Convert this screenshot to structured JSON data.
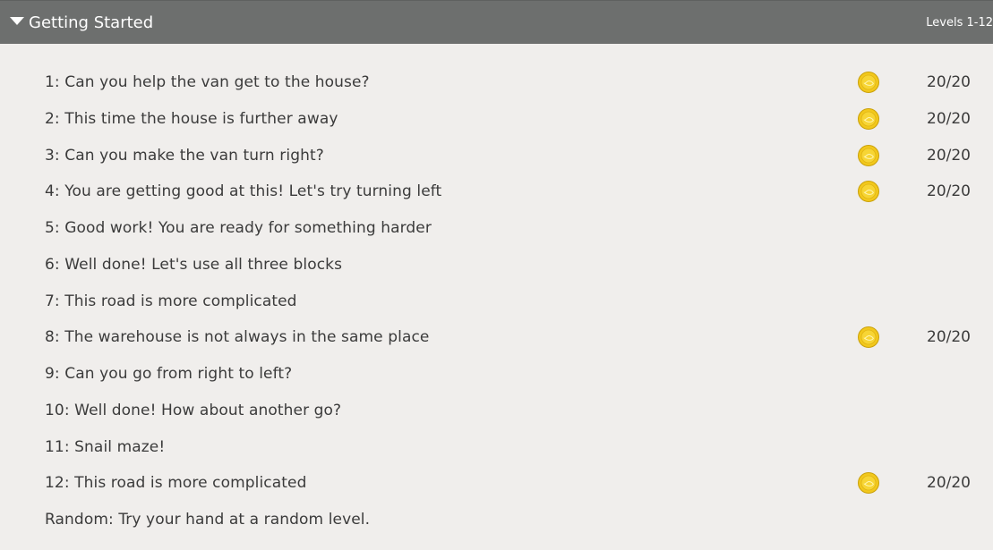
{
  "section": {
    "title": "Getting Started",
    "range": "Levels 1-12"
  },
  "levels": [
    {
      "label": "1: Can you help the van get to the house?",
      "score": "20/20",
      "coin": true
    },
    {
      "label": "2: This time the house is further away",
      "score": "20/20",
      "coin": true
    },
    {
      "label": "3: Can you make the van turn right?",
      "score": "20/20",
      "coin": true
    },
    {
      "label": "4: You are getting good at this! Let's try turning left",
      "score": "20/20",
      "coin": true
    },
    {
      "label": "5: Good work! You are ready for something harder",
      "score": "",
      "coin": false
    },
    {
      "label": "6: Well done! Let's use all three blocks",
      "score": "",
      "coin": false
    },
    {
      "label": "7: This road is more complicated",
      "score": "",
      "coin": false
    },
    {
      "label": "8: The warehouse is not always in the same place",
      "score": "20/20",
      "coin": true
    },
    {
      "label": "9: Can you go from right to left?",
      "score": "",
      "coin": false
    },
    {
      "label": "10: Well done! How about another go?",
      "score": "",
      "coin": false
    },
    {
      "label": "11: Snail maze!",
      "score": "",
      "coin": false
    },
    {
      "label": "12: This road is more complicated",
      "score": "20/20",
      "coin": true
    },
    {
      "label": "Random: Try your hand at a random level.",
      "score": "",
      "coin": false
    }
  ],
  "icons": {
    "caret": "caret-down-icon",
    "coin": "gold-coin-icon"
  },
  "colors": {
    "header_bg": "#6d6f6e",
    "page_bg": "#f0eeec",
    "text": "#3b3b3b",
    "coin_gold": "#f2c81c"
  }
}
